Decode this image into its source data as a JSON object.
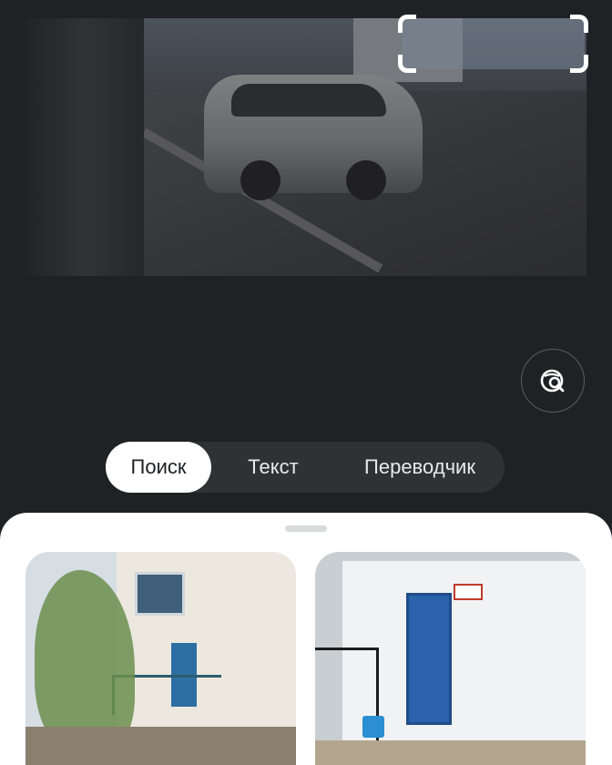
{
  "modes": {
    "tabs": [
      {
        "label": "Поиск",
        "active": true
      },
      {
        "label": "Текст",
        "active": false
      },
      {
        "label": "Переводчик",
        "active": false
      }
    ]
  },
  "preview": {
    "icon": "camera-preview"
  },
  "lens_button": {
    "icon": "lens-search-icon"
  },
  "results": {
    "items": [
      {
        "icon": "result-image-building-entrance"
      },
      {
        "icon": "result-image-blue-door"
      }
    ]
  },
  "colors": {
    "background": "#202125",
    "tab_bar": "#303134",
    "tab_active": "#ffffff",
    "sheet": "#ffffff"
  }
}
